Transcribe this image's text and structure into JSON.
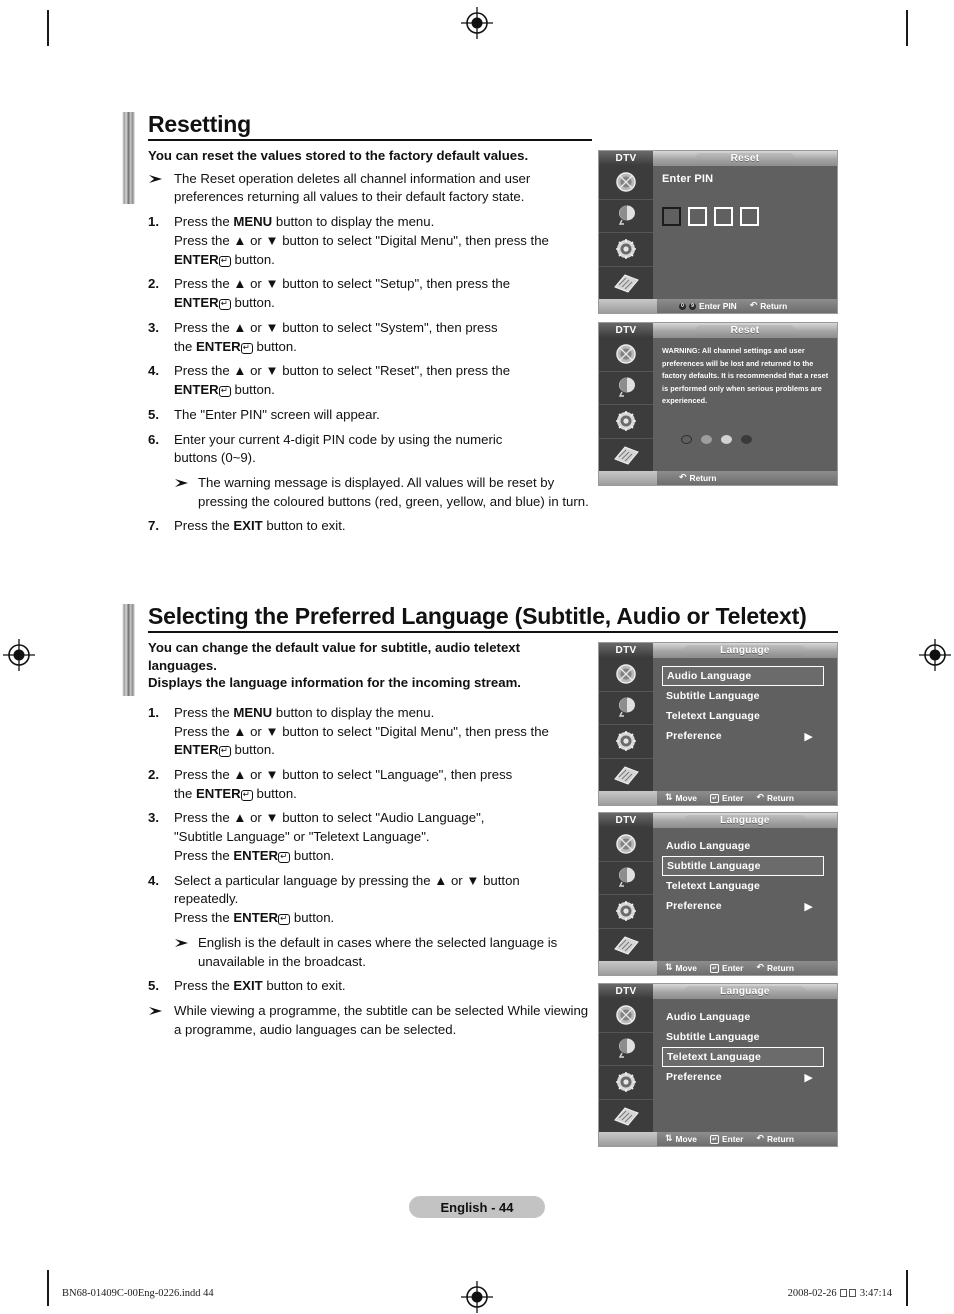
{
  "sections": [
    {
      "id": "resetting",
      "title": "Resetting",
      "lead": "You can reset the values stored to the factory default values.",
      "intro_note": "The Reset operation deletes all channel information and user preferences returning all values to their default factory state.",
      "steps": [
        {
          "num": "1.",
          "lines": [
            "Press the <b>MENU</b> button to display the menu.",
            "Press the <b>▲</b> or <b>▼</b> button to select \"Digital Menu\", then press the",
            "<b>ENTER</b><span class=\"enter-gl\">↵</span> button."
          ]
        },
        {
          "num": "2.",
          "lines": [
            "Press the <b>▲</b> or <b>▼</b> button to select \"Setup\", then press the",
            "<b>ENTER</b><span class=\"enter-gl\">↵</span> button."
          ]
        },
        {
          "num": "3.",
          "lines": [
            "Press the <b>▲</b> or <b>▼</b> button to select \"System\", then press",
            "the <b>ENTER</b><span class=\"enter-gl\">↵</span> button."
          ]
        },
        {
          "num": "4.",
          "lines": [
            "Press the <b>▲</b> or <b>▼</b> button to select \"Reset\", then press the",
            "<b>ENTER</b><span class=\"enter-gl\">↵</span> button."
          ]
        },
        {
          "num": "5.",
          "lines": [
            "The \"Enter PIN\" screen will appear."
          ]
        },
        {
          "num": "6.",
          "lines": [
            "Enter your current 4-digit PIN code by using the numeric",
            "buttons (0~9)."
          ]
        }
      ],
      "step6_note": "The warning message is displayed. All values will be reset by pressing the coloured buttons (red, green, yellow, and blue) in turn.",
      "step7": {
        "num": "7.",
        "lines": [
          "Press the <b>EXIT</b> button to exit."
        ]
      }
    },
    {
      "id": "language",
      "title": "Selecting the Preferred Language (Subtitle, Audio or Teletext)",
      "lead_line1": "You can change the default value for subtitle, audio teletext",
      "lead_line2": "languages.",
      "lead_line3": "Displays the language information for the incoming stream.",
      "steps": [
        {
          "num": "1.",
          "lines": [
            "Press the <b>MENU</b> button to display the menu.",
            "Press the <b>▲</b> or <b>▼</b> button to select \"Digital Menu\", then press the",
            "<b>ENTER</b><span class=\"enter-gl\">↵</span> button."
          ]
        },
        {
          "num": "2.",
          "lines": [
            "Press the <b>▲</b> or <b>▼</b> button to select \"Language\", then press",
            "the <b>ENTER</b><span class=\"enter-gl\">↵</span> button."
          ]
        },
        {
          "num": "3.",
          "lines": [
            "Press the <b>▲</b> or <b>▼</b> button to select \"Audio Language\",",
            "\"Subtitle Language\" or \"Teletext Language\".",
            "Press the <b>ENTER</b><span class=\"enter-gl\">↵</span> button."
          ]
        },
        {
          "num": "4.",
          "lines": [
            "Select a particular language by pressing the <b>▲</b> or <b>▼</b> button",
            "repeatedly.",
            "Press the <b>ENTER</b><span class=\"enter-gl\">↵</span> button."
          ]
        }
      ],
      "step4_note": "English is the default in cases where the selected language is unavailable in the broadcast.",
      "step5": {
        "num": "5.",
        "lines": [
          "Press the <b>EXIT</b> button to exit."
        ]
      },
      "final_note": "While viewing a programme, the subtitle can be selected While viewing a programme, audio languages can be selected."
    }
  ],
  "osd_screens": [
    {
      "id": "reset-pin",
      "source_label": "DTV",
      "title": "Reset",
      "content_type": "pin",
      "label": "Enter PIN",
      "pin_boxes": 4,
      "active_box": 0,
      "bottom_hints": [
        {
          "glyph": "0-9",
          "text": "Enter PIN"
        },
        {
          "glyph": "return",
          "text": "Return"
        }
      ]
    },
    {
      "id": "reset-warning",
      "source_label": "DTV",
      "title": "Reset",
      "content_type": "warning",
      "warning_text": "WARNING: All channel settings and user preferences will be lost and returned to the factory defaults. It is recommended that a reset is performed only when serious problems are experienced.",
      "colour_dots": [
        {
          "name": "red-button",
          "hex": "#5f5f5f"
        },
        {
          "name": "green-button",
          "hex": "#9e9e9e"
        },
        {
          "name": "yellow-button",
          "hex": "#d2d2d2"
        },
        {
          "name": "blue-button",
          "hex": "#3a3a3a"
        }
      ],
      "bottom_hints": [
        {
          "glyph": "return",
          "text": "Return"
        }
      ]
    },
    {
      "id": "language-audio",
      "source_label": "DTV",
      "title": "Language",
      "content_type": "menu",
      "items": [
        {
          "label": "Audio Language",
          "selected": true,
          "arrow": false
        },
        {
          "label": "Subtitle Language",
          "selected": false,
          "arrow": false
        },
        {
          "label": "Teletext Language",
          "selected": false,
          "arrow": false
        },
        {
          "label": "Preference",
          "selected": false,
          "arrow": true
        }
      ],
      "bottom_hints": [
        {
          "glyph": "move",
          "text": "Move"
        },
        {
          "glyph": "enter",
          "text": "Enter"
        },
        {
          "glyph": "return",
          "text": "Return"
        }
      ]
    },
    {
      "id": "language-subtitle",
      "source_label": "DTV",
      "title": "Language",
      "content_type": "menu",
      "items": [
        {
          "label": "Audio Language",
          "selected": false,
          "arrow": false
        },
        {
          "label": "Subtitle Language",
          "selected": true,
          "arrow": false
        },
        {
          "label": "Teletext Language",
          "selected": false,
          "arrow": false
        },
        {
          "label": "Preference",
          "selected": false,
          "arrow": true
        }
      ],
      "bottom_hints": [
        {
          "glyph": "move",
          "text": "Move"
        },
        {
          "glyph": "enter",
          "text": "Enter"
        },
        {
          "glyph": "return",
          "text": "Return"
        }
      ]
    },
    {
      "id": "language-teletext",
      "source_label": "DTV",
      "title": "Language",
      "content_type": "menu",
      "items": [
        {
          "label": "Audio Language",
          "selected": false,
          "arrow": false
        },
        {
          "label": "Subtitle Language",
          "selected": false,
          "arrow": false
        },
        {
          "label": "Teletext Language",
          "selected": true,
          "arrow": false
        },
        {
          "label": "Preference",
          "selected": false,
          "arrow": true
        }
      ],
      "bottom_hints": [
        {
          "glyph": "move",
          "text": "Move"
        },
        {
          "glyph": "enter",
          "text": "Enter"
        },
        {
          "glyph": "return",
          "text": "Return"
        }
      ]
    }
  ],
  "footer": {
    "page_badge": "English - 44",
    "print_file": "BN68-01409C-00Eng-0226.indd   44",
    "print_date": "2008-02-26",
    "print_time": "3:47:14"
  }
}
